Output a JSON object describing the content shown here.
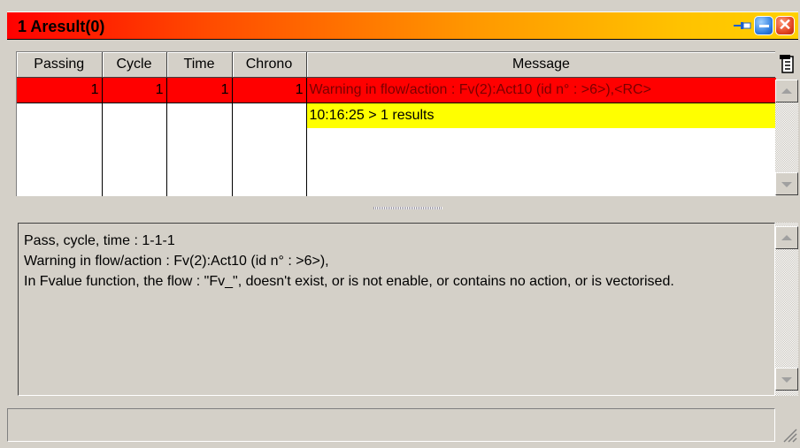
{
  "window": {
    "title": "1  Aresult(0)"
  },
  "grid": {
    "columns": [
      "Passing",
      "Cycle",
      "Time",
      "Chrono",
      "Message"
    ],
    "rows": [
      {
        "passing": "1",
        "cycle": "1",
        "time": "1",
        "chrono": "1",
        "message": "Warning in  flow/action : Fv(2):Act10  (id n° : >6>),<RC>"
      },
      {
        "passing": "",
        "cycle": "",
        "time": "",
        "chrono": "",
        "message": "10:16:25 > 1 results"
      }
    ]
  },
  "detail": {
    "lines": [
      "Pass, cycle, time : 1-1-1",
      "Warning in  flow/action : Fv(2):Act10  (id n° : >6>),",
      "In Fvalue function, the flow : \"Fv_\", doesn't exist, or is not enable, or contains no action, or is vectorised."
    ]
  },
  "colors": {
    "warning_row": "#ff0000",
    "result_row": "#ffff00",
    "titlebar_start": "#ff0000",
    "titlebar_end": "#ffd000"
  },
  "icons": {
    "pin": "pin-icon",
    "minimize": "minimize-icon",
    "close": "close-icon",
    "column_chooser": "column-chooser-icon"
  }
}
